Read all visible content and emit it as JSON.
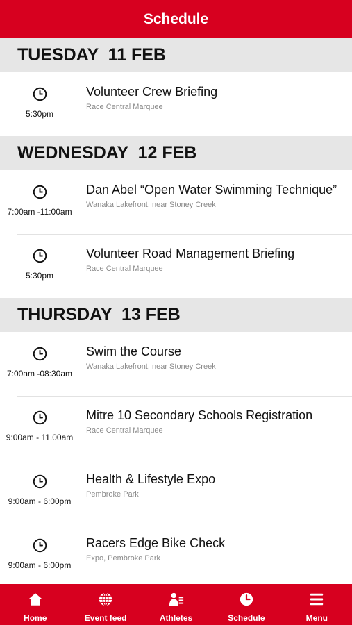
{
  "header": {
    "title": "Schedule"
  },
  "days": [
    {
      "label": "TUESDAY  11 FEB",
      "events": [
        {
          "time": "5:30pm",
          "title": "Volunteer Crew Briefing",
          "location": "Race Central Marquee"
        }
      ]
    },
    {
      "label": "WEDNESDAY  12 FEB",
      "events": [
        {
          "time": "7:00am -11:00am",
          "title": "Dan Abel “Open Water Swimming Technique”",
          "location": "Wanaka Lakefront, near Stoney Creek"
        },
        {
          "time": "5:30pm",
          "title": "Volunteer Road Management Briefing",
          "location": "Race Central Marquee"
        }
      ]
    },
    {
      "label": "THURSDAY  13 FEB",
      "events": [
        {
          "time": "7:00am -08:30am",
          "title": "Swim the Course",
          "location": "Wanaka Lakefront, near Stoney Creek"
        },
        {
          "time": "9:00am - 11.00am",
          "title": "Mitre 10 Secondary Schools Registration",
          "location": "Race Central Marquee"
        },
        {
          "time": "9:00am - 6:00pm",
          "title": "Health & Lifestyle Expo",
          "location": "Pembroke Park"
        },
        {
          "time": "9:00am - 6:00pm",
          "title": "Racers Edge Bike Check",
          "location": "Expo, Pembroke Park"
        }
      ]
    }
  ],
  "tabbar": {
    "items": [
      {
        "label": "Home",
        "icon": "home-icon"
      },
      {
        "label": "Event feed",
        "icon": "globe-icon"
      },
      {
        "label": "Athletes",
        "icon": "athletes-icon"
      },
      {
        "label": "Schedule",
        "icon": "clock-icon"
      },
      {
        "label": "Menu",
        "icon": "menu-icon"
      }
    ]
  },
  "colors": {
    "brand": "#d7001f",
    "day_header_bg": "#e6e6e6",
    "text": "#111111",
    "muted": "#8a8a8a"
  }
}
